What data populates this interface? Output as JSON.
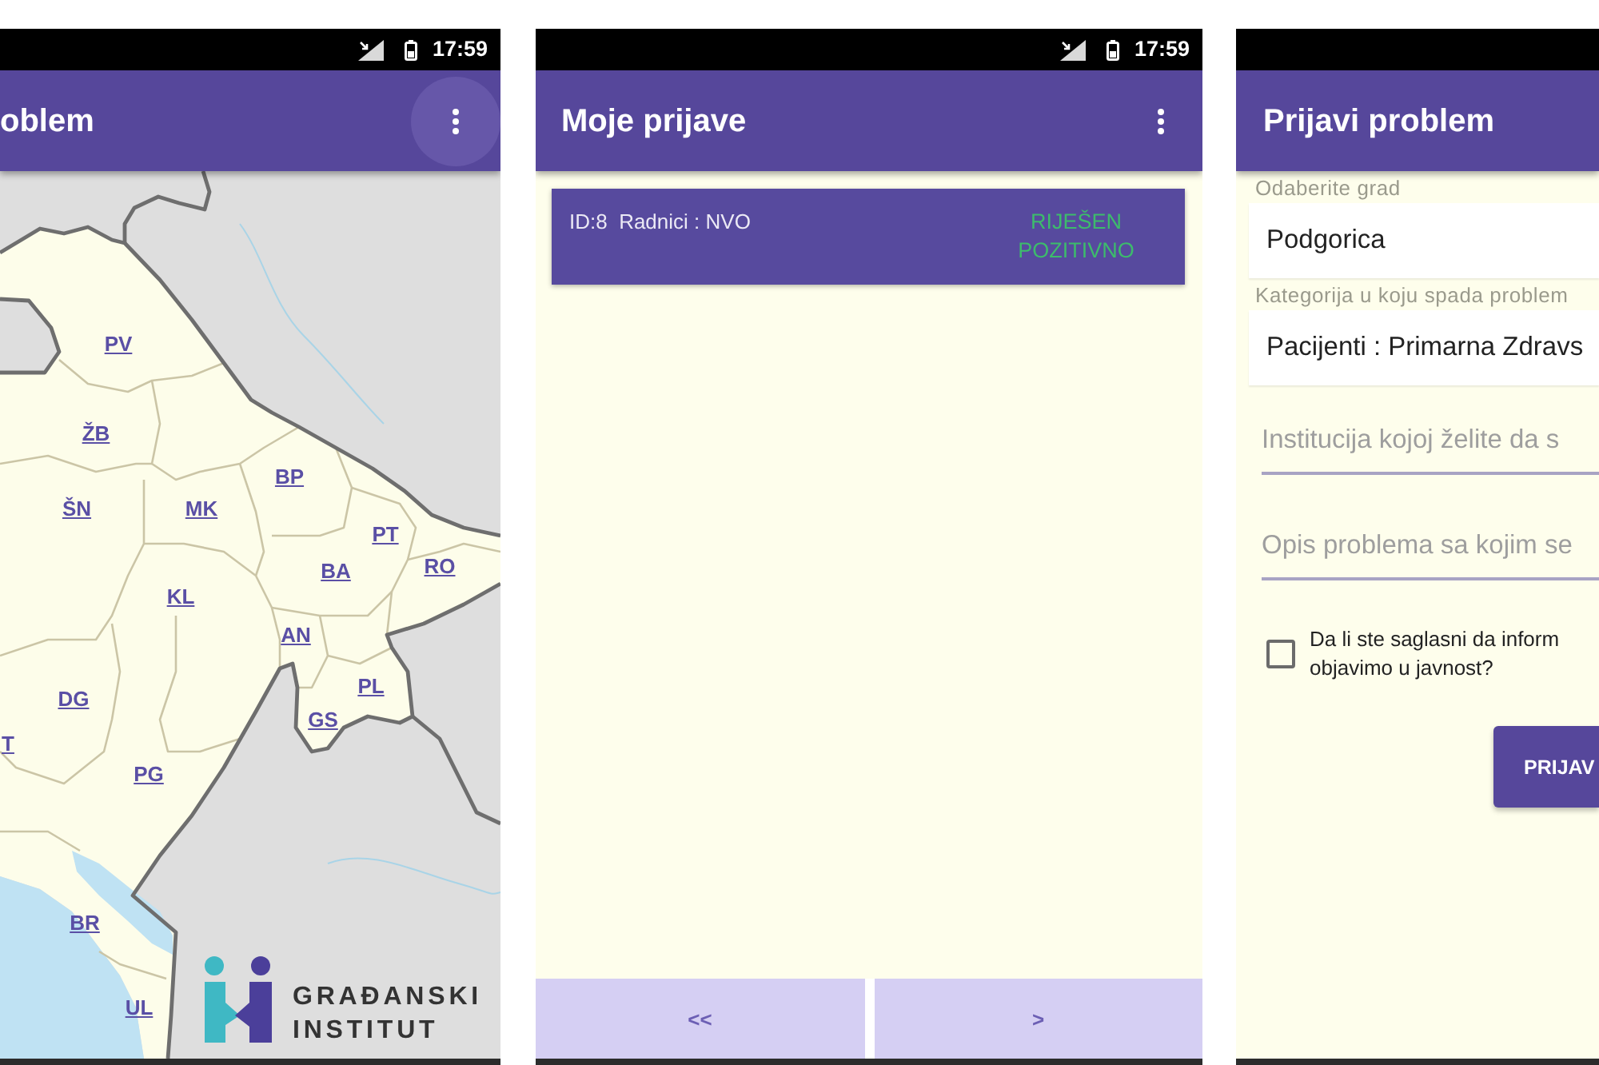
{
  "screens": [
    {
      "kind": "map",
      "status_bar": {
        "time": "17:59"
      },
      "app_bar": {
        "title": "oblem",
        "menu": {
          "pressed": true
        }
      },
      "map": {
        "municipalities": [
          "PV",
          "ŽB",
          "BP",
          "ŠN",
          "MK",
          "PT",
          "RO",
          "BA",
          "KL",
          "AN",
          "PL",
          "DG",
          "T",
          "GS",
          "PG",
          "BR",
          "UL"
        ],
        "logo": {
          "lines": [
            "GRAĐANSKI",
            "INSTITUT"
          ]
        }
      }
    },
    {
      "kind": "list",
      "status_bar": {
        "time": "17:59"
      },
      "app_bar": {
        "title": "Moje prijave",
        "menu": {
          "pressed": false
        }
      },
      "reports": [
        {
          "title": "ID:8  Radnici : NVO",
          "status": "RIJEŠEN POZITIVNO"
        }
      ],
      "pager": [
        {
          "label": "<<",
          "disabled": true
        },
        {
          "label": ">",
          "disabled": true
        }
      ]
    },
    {
      "kind": "form",
      "app_bar": {
        "title": "Prijavi problem"
      },
      "form": {
        "fields": [
          {
            "kind": "dropdown",
            "label": "Odaberite grad",
            "value": "Podgorica"
          },
          {
            "kind": "dropdown",
            "label": "Kategorija u koju spada problem",
            "value": "Pacijenti : Primarna Zdravs"
          },
          {
            "kind": "text",
            "placeholder": "Institucija kojoj želite da s"
          },
          {
            "kind": "text",
            "placeholder": "Opis problema sa kojim se"
          },
          {
            "kind": "checkbox",
            "checked": false,
            "lines": [
              "Da li ste saglasni da inform",
              "objavimo u javnost?"
            ]
          }
        ],
        "submit": "PRIJAV"
      }
    }
  ]
}
